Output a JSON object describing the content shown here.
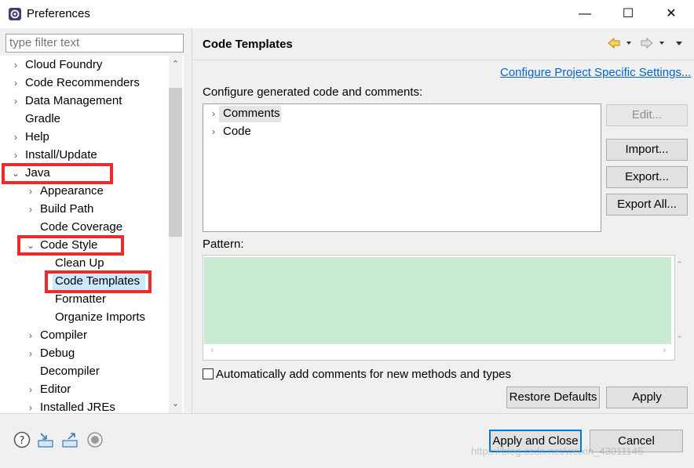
{
  "window": {
    "title": "Preferences",
    "minimize": "—",
    "maximize": "☐",
    "close": "✕"
  },
  "filter": {
    "placeholder": "type filter text"
  },
  "tree": {
    "items": [
      {
        "label": "Cloud Foundry",
        "expanded": false
      },
      {
        "label": "Code Recommenders",
        "expanded": false
      },
      {
        "label": "Data Management",
        "expanded": false
      },
      {
        "label": "Gradle",
        "leaf": true
      },
      {
        "label": "Help",
        "expanded": false
      },
      {
        "label": "Install/Update",
        "expanded": false
      },
      {
        "label": "Java",
        "expanded": true
      },
      {
        "label": "Appearance",
        "expanded": false
      },
      {
        "label": "Build Path",
        "expanded": false
      },
      {
        "label": "Code Coverage",
        "leaf": true
      },
      {
        "label": "Code Style",
        "expanded": true
      },
      {
        "label": "Clean Up",
        "leaf": true
      },
      {
        "label": "Code Templates",
        "leaf": true,
        "selected": true
      },
      {
        "label": "Formatter",
        "leaf": true
      },
      {
        "label": "Organize Imports",
        "leaf": true
      },
      {
        "label": "Compiler",
        "expanded": false
      },
      {
        "label": "Debug",
        "expanded": false
      },
      {
        "label": "Decompiler",
        "leaf": true
      },
      {
        "label": "Editor",
        "expanded": false
      },
      {
        "label": "Installed JREs",
        "expanded": false
      }
    ]
  },
  "main": {
    "title": "Code Templates",
    "config_link": "Configure Project Specific Settings...",
    "config_label": "Configure generated code and comments:",
    "templates": [
      "Comments",
      "Code"
    ],
    "buttons": {
      "edit": "Edit...",
      "import": "Import...",
      "export": "Export...",
      "export_all": "Export All..."
    },
    "pattern_label": "Pattern:",
    "checkbox_label": "Automatically add comments for new methods and types",
    "checkbox_checked": false,
    "restore_defaults": "Restore Defaults",
    "apply": "Apply"
  },
  "footer": {
    "apply_close": "Apply and Close",
    "cancel": "Cancel",
    "icons": [
      "help-icon",
      "import-prefs-icon",
      "export-prefs-icon",
      "oomph-record-icon"
    ]
  },
  "colors": {
    "highlight": "#ee2a2a",
    "selection": "#cce8ff",
    "pattern_bg": "#c8ebd1",
    "link": "#0066cc"
  },
  "watermark": "https://blog.csdn.net/weixin_43011145"
}
